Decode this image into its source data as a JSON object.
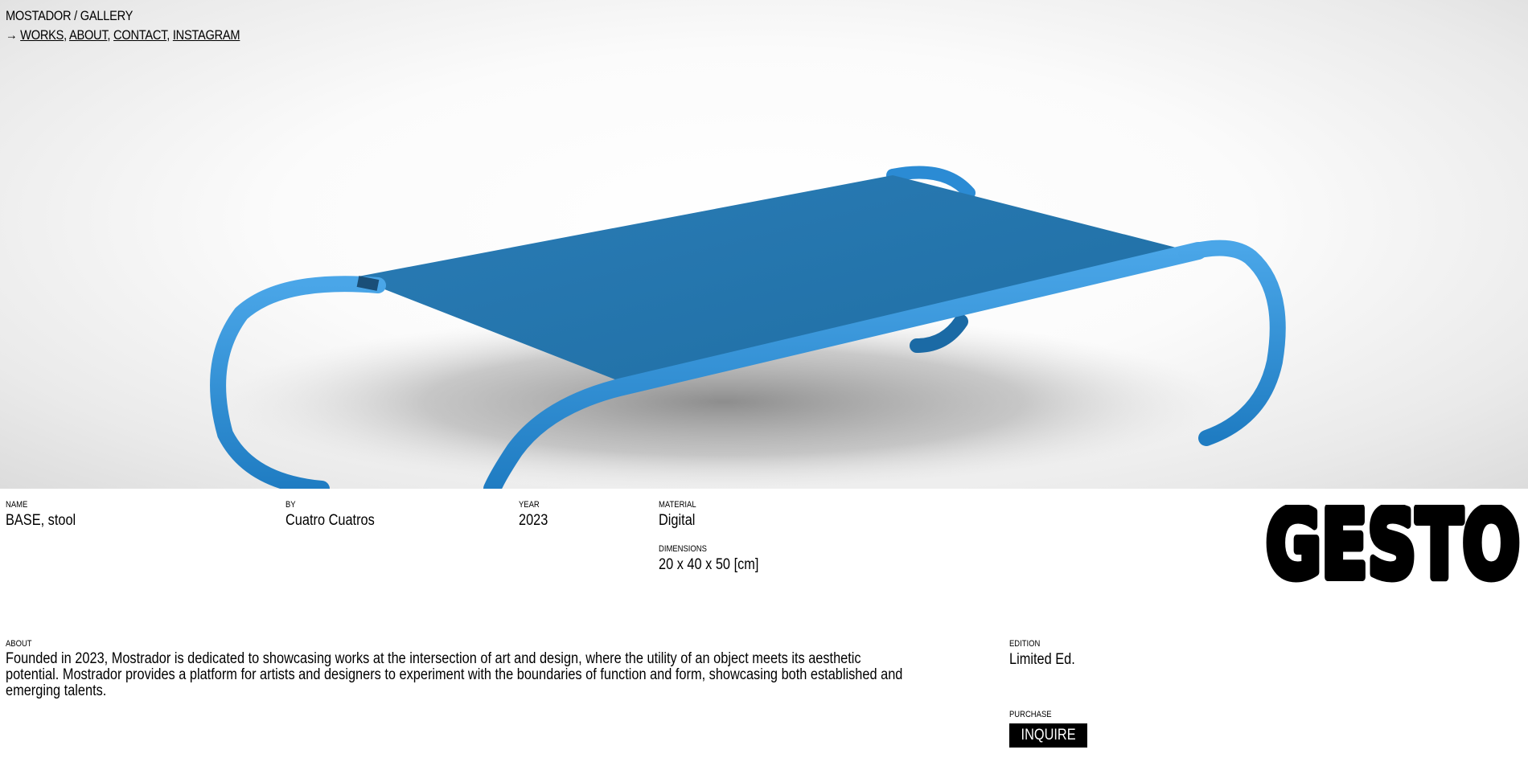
{
  "header": {
    "site_title": "MOSTADOR / GALLERY",
    "nav_arrow": "→",
    "nav": [
      {
        "label": "WORKS"
      },
      {
        "label": "ABOUT"
      },
      {
        "label": "CONTACT"
      },
      {
        "label": "INSTAGRAM"
      }
    ],
    "separator": ","
  },
  "work": {
    "name_label": "NAME",
    "name_value": "BASE, stool",
    "by_label": "BY",
    "by_value": "Cuatro Cuatros",
    "year_label": "YEAR",
    "year_value": "2023",
    "material_label": "MATERIAL",
    "material_value": "Digital",
    "dimensions_label": "DIMENSIONS",
    "dimensions_value": "20 x 40 x 50 [cm]"
  },
  "about": {
    "label": "ABOUT",
    "text": "Founded in 2023, Mostrador is dedicated to showcasing works at the intersection of art and design, where the utility of an object meets its aesthetic potential. Mostrador provides a platform for artists and designers to experiment with the boundaries of function and form, showcasing both established and emerging talents."
  },
  "edition": {
    "label": "EDITION",
    "value": "Limited Ed."
  },
  "purchase": {
    "label": "PURCHASE",
    "button": "INQUIRE"
  },
  "logo": {
    "text": "GESTO"
  },
  "colors": {
    "object_blue": "#2b8bd4",
    "seat_blue": "#2274a8",
    "text": "#000000",
    "button_bg": "#000000",
    "button_text": "#ffffff"
  }
}
